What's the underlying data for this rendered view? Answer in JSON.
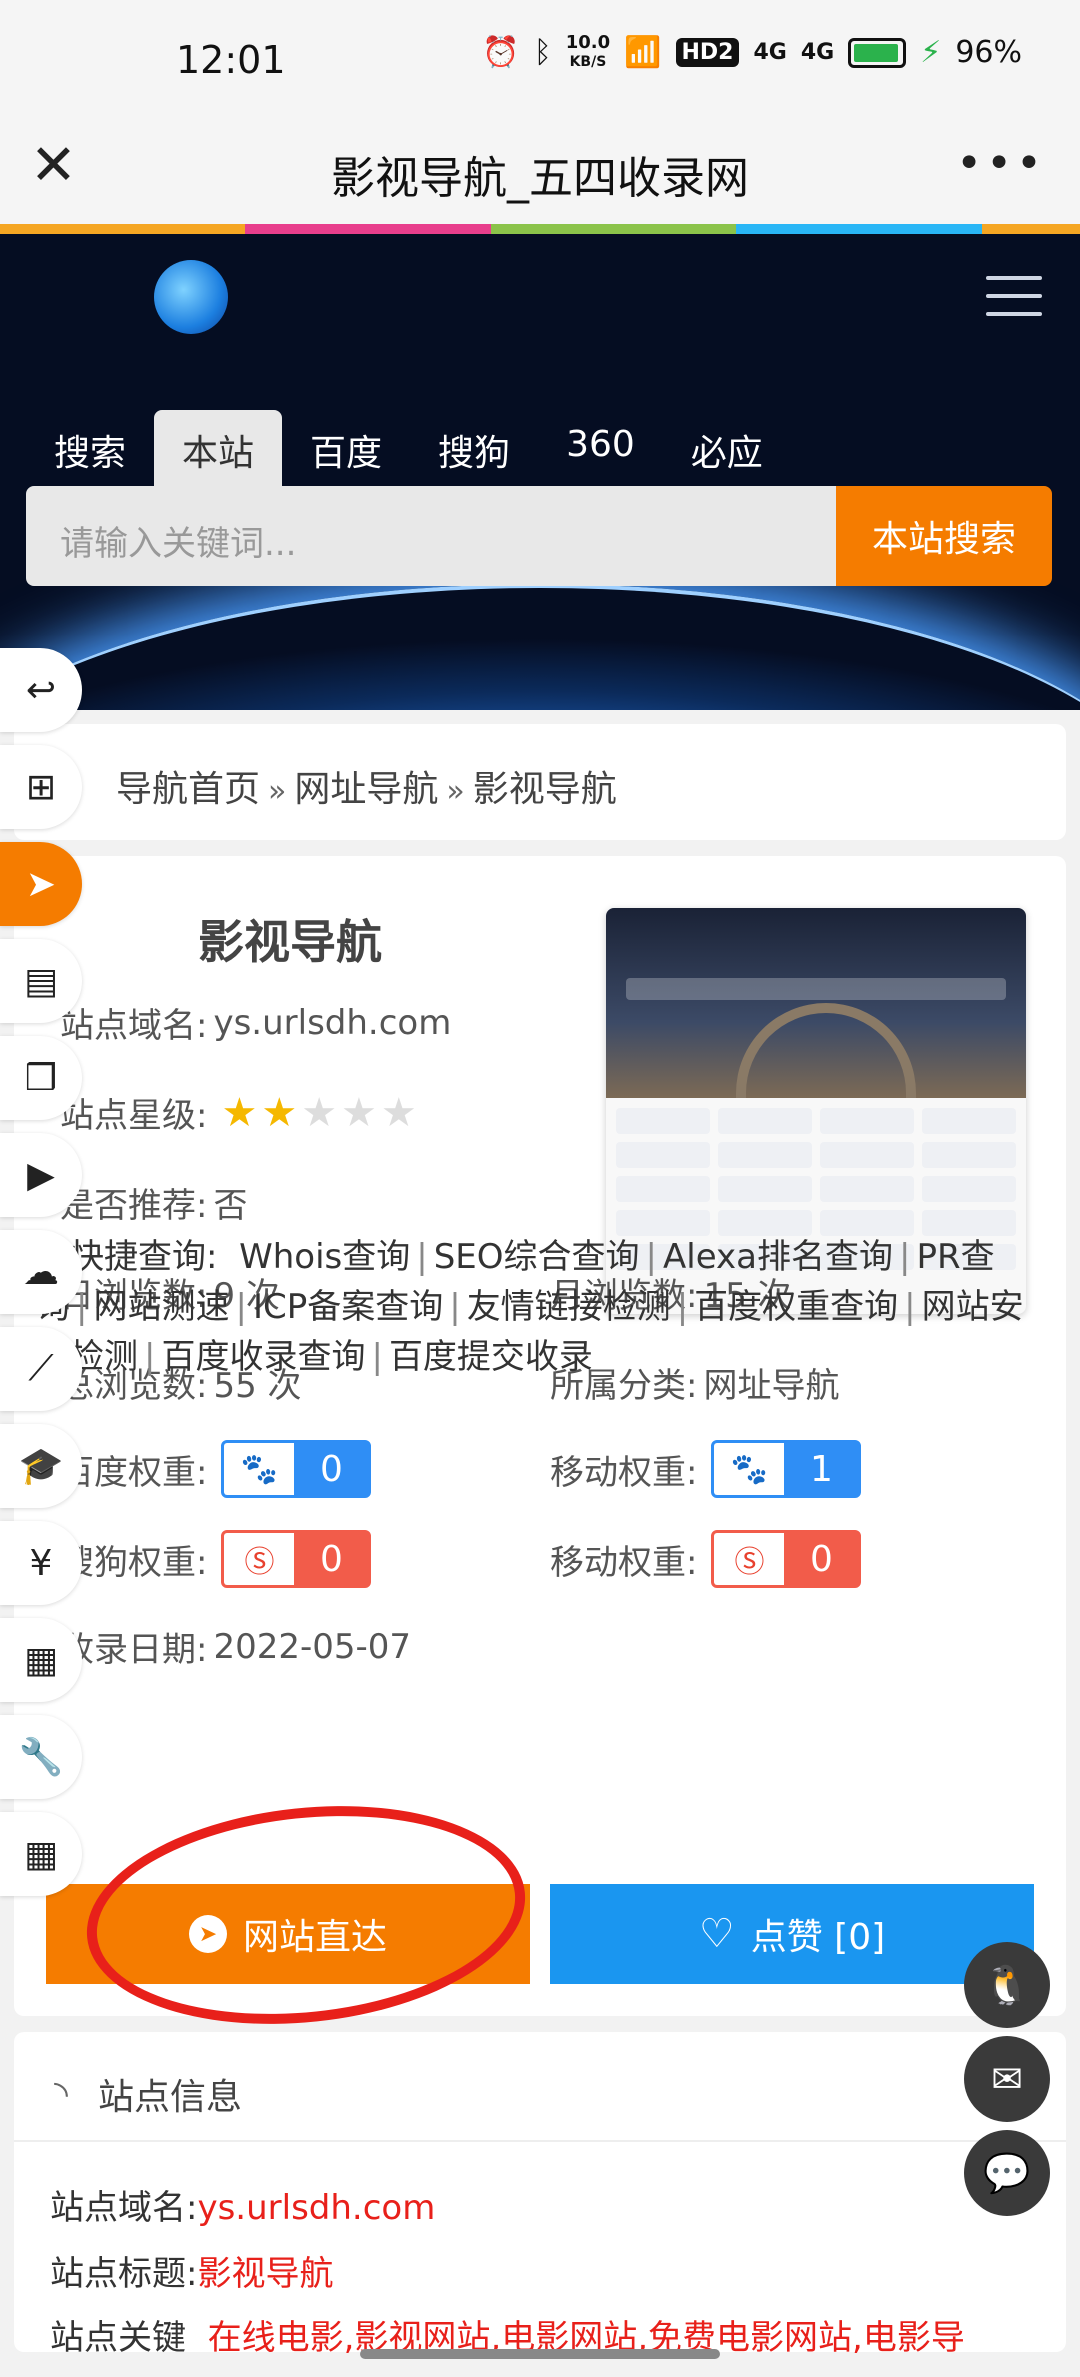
{
  "status": {
    "time": "12:01",
    "net_speed": "10.0",
    "net_unit": "KB/S",
    "hd": "HD2",
    "sig1": "4G",
    "sig2": "4G",
    "battery": "96%"
  },
  "appbar": {
    "title": "影视导航_五四收录网"
  },
  "colors": {
    "bar": [
      "#f5a623",
      "#e83e8c",
      "#8bc34a",
      "#29b6f6",
      "#f5a623"
    ],
    "accent": "#f57c00",
    "blue": "#1a96f0",
    "red": "#e8201a"
  },
  "search": {
    "tabs": [
      "搜索",
      "本站",
      "百度",
      "搜狗",
      "360",
      "必应"
    ],
    "active_tab": "本站",
    "placeholder": "请输入关键词...",
    "button": "本站搜索"
  },
  "breadcrumb": {
    "items": [
      "导航首页",
      "网址导航",
      "影视导航"
    ],
    "sep": "»"
  },
  "site": {
    "title": "影视导航",
    "domain_label": "站点域名:",
    "domain": "ys.urlsdh.com",
    "stars_label": "站点星级:",
    "stars": 2,
    "stars_max": 5,
    "recommend_label": "是否推荐:",
    "recommend": "否",
    "day_views_label": "日浏览数:",
    "day_views": "9 次",
    "month_views_label": "月浏览数:",
    "month_views": "15 次",
    "total_views_label": "总浏览数:",
    "total_views": "55 次",
    "category_label": "所属分类:",
    "category": "网址导航",
    "baidu_w_label": "百度权重:",
    "baidu_w": "0",
    "mobile_w_label": "移动权重:",
    "mobile_w": "1",
    "sogou_w_label": "搜狗权重:",
    "sogou_w": "0",
    "mobile_w2_label": "移动权重:",
    "mobile_w2": "0",
    "date_label": "收录日期:",
    "date": "2022-05-07",
    "quick_label": "网快捷查询:",
    "quick_links": [
      "Whois查询",
      "SEO综合查询",
      "Alexa排名查询",
      "PR查询",
      "网站测速",
      "ICP备案查询",
      "友情链接检测",
      "百度权重查询",
      "网站安全检测",
      "百度收录查询",
      "百度提交收录"
    ]
  },
  "actions": {
    "visit": "网站直达",
    "like": "点赞 [0]"
  },
  "info": {
    "header": "站点信息",
    "domain_label": "站点域名:",
    "domain": "ys.urlsdh.com",
    "title_label": "站点标题:",
    "title": "影视导航",
    "keywords_label": "站点关键",
    "keywords": "在线电影,影视网站,电影网站,免费电影网站,电影导"
  }
}
